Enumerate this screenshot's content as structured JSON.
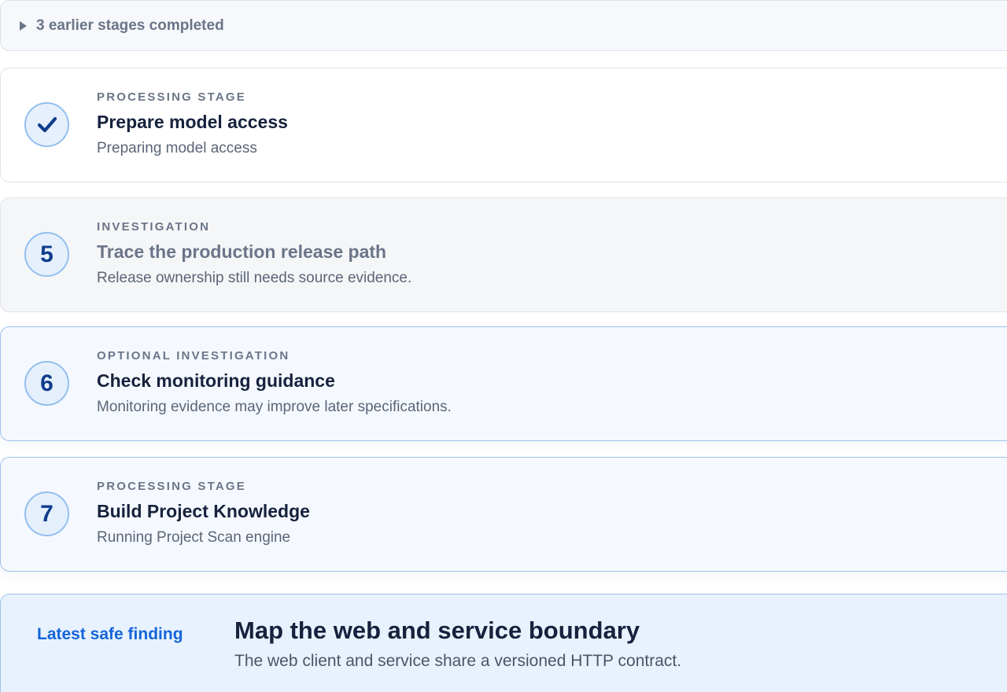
{
  "collapsed": {
    "label": "3 earlier stages completed",
    "icon": "caret-right-icon"
  },
  "stages": [
    {
      "eyebrow": "PROCESSING STAGE",
      "title": "Prepare model access",
      "description": "Preparing model access",
      "status": "completed",
      "icon": "checkmark-icon"
    },
    {
      "number": "5",
      "eyebrow": "INVESTIGATION",
      "title": "Trace the production release path",
      "description": "Release ownership still needs source evidence.",
      "status": "pending"
    },
    {
      "number": "6",
      "eyebrow": "OPTIONAL INVESTIGATION",
      "title": "Check monitoring guidance",
      "description": "Monitoring evidence may improve later specifications.",
      "status": "active"
    },
    {
      "number": "7",
      "eyebrow": "PROCESSING STAGE",
      "title": "Build Project Knowledge",
      "description": "Running Project Scan engine",
      "status": "active"
    }
  ],
  "finding": {
    "label": "Latest safe finding",
    "title": "Map the web and service boundary",
    "description": "The web client and service share a versioned HTTP contract."
  },
  "colors": {
    "accent": "#1565d8",
    "navy": "#16223d",
    "muted": "#6b7588",
    "circle_border": "#93c0ef",
    "circle_fill": "#e6f0fc"
  }
}
